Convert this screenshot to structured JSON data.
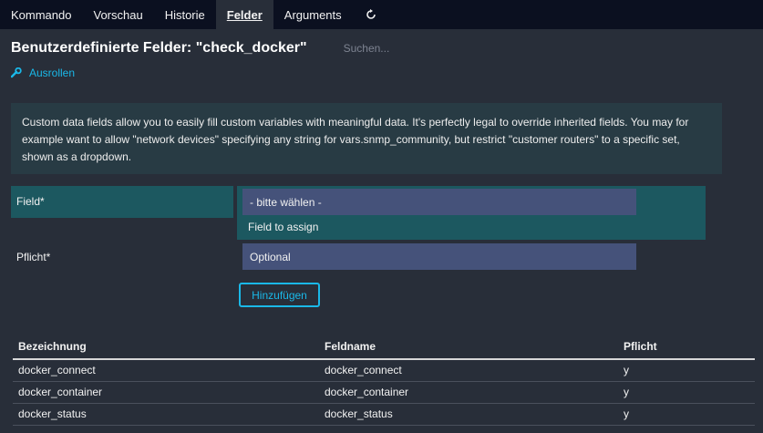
{
  "tabs": [
    {
      "label": "Kommando"
    },
    {
      "label": "Vorschau"
    },
    {
      "label": "Historie"
    },
    {
      "label": "Felder"
    },
    {
      "label": "Arguments"
    }
  ],
  "header": {
    "title": "Benutzerdefinierte Felder: \"check_docker\"",
    "search_placeholder": "Suchen..."
  },
  "expand_label": "Ausrollen",
  "info_text": "Custom data fields allow you to easily fill custom variables with meaningful data. It's perfectly legal to override inherited fields. You may for example want to allow \"network devices\" specifying any string for vars.snmp_community, but restrict \"customer routers\" to a specific set, shown as a dropdown.",
  "form": {
    "field_label": "Field*",
    "field_select_value": "- bitte wählen -",
    "field_hint": "Field to assign",
    "pflicht_label": "Pflicht*",
    "pflicht_select_value": "Optional",
    "add_button_label": "Hinzufügen"
  },
  "table": {
    "headers": [
      "Bezeichnung",
      "Feldname",
      "Pflicht"
    ],
    "rows": [
      [
        "docker_connect",
        "docker_connect",
        "y"
      ],
      [
        "docker_container",
        "docker_container",
        "y"
      ],
      [
        "docker_status",
        "docker_status",
        "y"
      ]
    ]
  },
  "colors": {
    "accent": "#1ab8e8",
    "tabbar_bg": "#0b1020",
    "page_bg": "#282e39",
    "highlight_bg": "#1c5860",
    "select_bg": "#45527a"
  }
}
